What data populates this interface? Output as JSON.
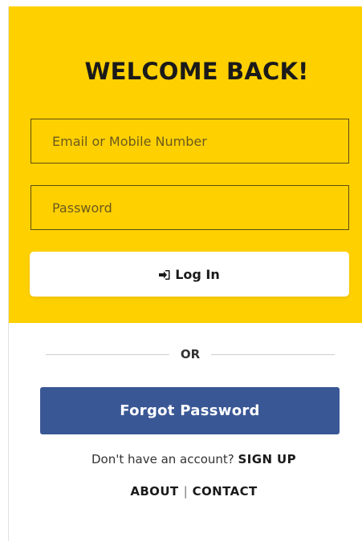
{
  "login": {
    "title": "WELCOME BACK!",
    "email_placeholder": "Email or Mobile Number",
    "password_placeholder": "Password",
    "login_label": "Log In",
    "login_icon": "sign-in-icon"
  },
  "divider": {
    "label": "OR"
  },
  "forgot": {
    "label": "Forgot Password"
  },
  "signup": {
    "prompt": "Don't have an account?",
    "link": "SIGN UP"
  },
  "footer_links": {
    "about": "ABOUT",
    "separator": "|",
    "contact": "CONTACT"
  },
  "colors": {
    "accent": "#ffd000",
    "forgot_button": "#3a5795"
  }
}
